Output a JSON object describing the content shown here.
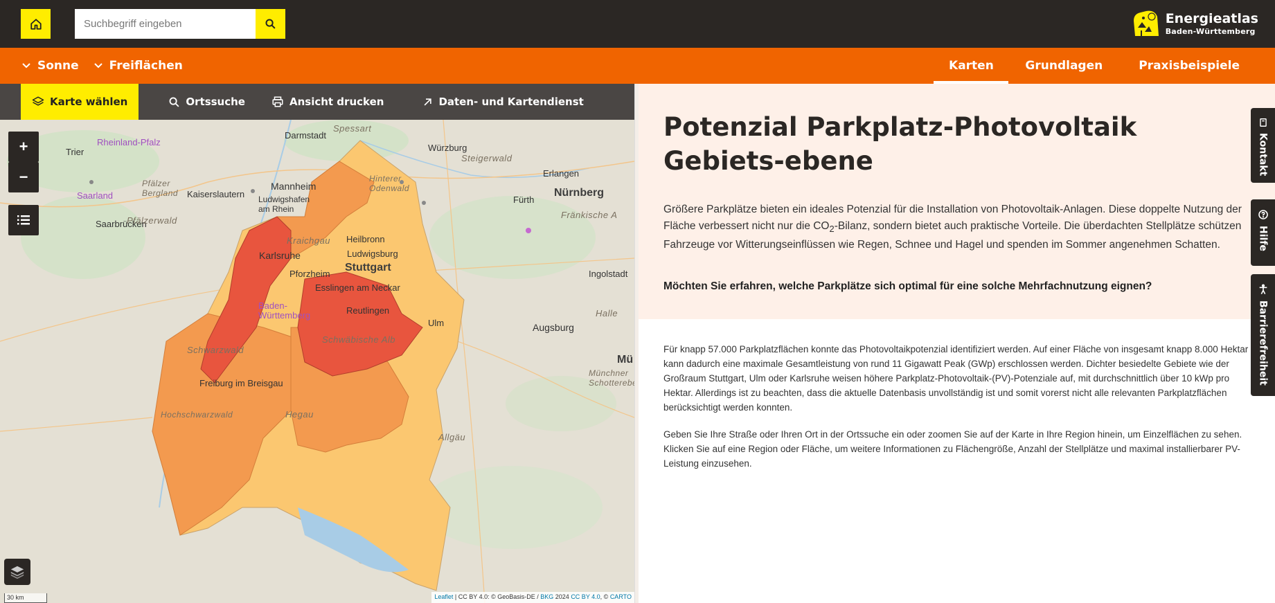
{
  "header": {
    "search_placeholder": "Suchbegriff eingeben",
    "logo_title": "Energieatlas",
    "logo_subtitle": "Baden-Württemberg"
  },
  "nav": {
    "dropdowns": [
      "Sonne",
      "Freiflächen"
    ],
    "links": [
      "Karten",
      "Grundlagen",
      "Praxisbeispiele"
    ],
    "active_link": "Karten"
  },
  "toolbar": {
    "choose_map": "Karte wählen",
    "place_search": "Ortssuche",
    "print_view": "Ansicht drucken",
    "data_service": "Daten- und Kartendienst"
  },
  "map": {
    "zoom_in": "+",
    "zoom_out": "−",
    "scale_label": "30 km",
    "attribution": {
      "leaflet": "Leaflet",
      "part1": " | CC BY 4.0: © GeoBasis-DE / ",
      "bkg": "BKG",
      "year": " 2024 ",
      "ccby": "CC BY 4.0",
      "sep": ", © ",
      "carto": "CARTO"
    },
    "labels": {
      "darmstadt": "Darmstadt",
      "spessart": "Spessart",
      "wuerzburg": "Würzburg",
      "steigerwald": "Steigerwald",
      "trier": "Trier",
      "rheinland_pfalz": "Rheinland-Pfalz",
      "mannheim": "Mannheim",
      "hinterer_odenwald": "Hinterer\nOdenwald",
      "erlangen": "Erlangen",
      "fuerth": "Fürth",
      "nuernberg": "Nürnberg",
      "pfaelzer_bergland": "Pfälzer\nBergland",
      "kaiserslautern": "Kaiserslautern",
      "ludwigshafen": "Ludwigshafen\nam Rhein",
      "saarland": "Saarland",
      "saarbruecken": "Saarbrücken",
      "pfaelzerwald": "Pfälzerwald",
      "kraichgau": "Kraichgau",
      "heilbronn": "Heilbronn",
      "fraenkische_alb": "Fränkische A",
      "karlsruhe": "Karlsruhe",
      "ludwigsburg": "Ludwigsburg",
      "pforzheim": "Pforzheim",
      "stuttgart": "Stuttgart",
      "ingolstadt": "Ingolstadt",
      "esslingen": "Esslingen am Neckar",
      "baden_wuerttemberg": "Baden-\nWürttemberg",
      "reutlingen": "Reutlingen",
      "halle": "Halle",
      "ulm": "Ulm",
      "augsburg": "Augsburg",
      "schwarzwald": "Schwarzwald",
      "schwaebische_alb": "Schwäbische Alb",
      "muenchen_short": "Mü",
      "muenchener_schotterebene": "Münchner\nSchotterebe",
      "freiburg": "Freiburg im Breisgau",
      "hochschwarzwald": "Hochschwarzwald",
      "hegau": "Hegau",
      "allgaeu": "Allgäu"
    }
  },
  "content": {
    "title": "Potenzial Parkplatz-Photovoltaik Gebiets-ebene",
    "intro_a": "Größere Parkplätze bieten ein ideales Potenzial für die Installation von Photovoltaik-Anlagen. Diese doppelte Nutzung der Fläche verbessert nicht nur die CO",
    "intro_sub": "2",
    "intro_b": "-Bilanz, sondern bietet auch praktische Vorteile. Die überdachten Stellplätze schützen Fahrzeuge vor Witterungseinflüssen wie Regen, Schnee und Hagel und spenden im Sommer angenehmen Schatten.",
    "question": "Möchten Sie erfahren, welche Parkplätze sich optimal für eine solche Mehrfachnutzung eignen?",
    "para2": "Für knapp 57.000 Parkplatzflächen konnte das Photovoltaikpotenzial identifiziert werden. Auf einer Fläche von insgesamt knapp 8.000 Hektar kann dadurch eine maximale Gesamtleistung von rund 11 Gigawatt Peak (GWp) erschlossen werden. Dichter besiedelte Gebiete wie der Großraum Stuttgart, Ulm oder Karlsruhe weisen höhere Parkplatz-Photovoltaik-(PV)-Potenziale auf, mit durchschnittlich über 10 kWp pro Hektar. Allerdings ist zu beachten, dass die aktuelle Datenbasis unvollständig ist und somit vorerst nicht alle relevanten Parkplatzflächen berücksichtigt werden konnten.",
    "para3": "Geben Sie Ihre Straße oder Ihren Ort in der Ortssuche ein oder zoomen Sie auf der Karte in Ihre Region hinein, um Einzelflächen zu sehen. Klicken Sie auf eine Region oder Fläche, um weitere Informationen zu Flächengröße, Anzahl der Stellplätze und maximal installierbarer PV-Leistung einzusehen."
  },
  "sidetabs": [
    "Kontakt",
    "Hilfe",
    "Barrierefreiheit"
  ],
  "colors": {
    "topbar": "#2b2724",
    "accent_yellow": "#ffed00",
    "nav_orange": "#f06400",
    "toolbar": "#4a4644",
    "panel_bg": "#fef0e8",
    "region_dark": "#e8553e",
    "region_mid": "#f39a4f",
    "region_light": "#fbc770"
  }
}
